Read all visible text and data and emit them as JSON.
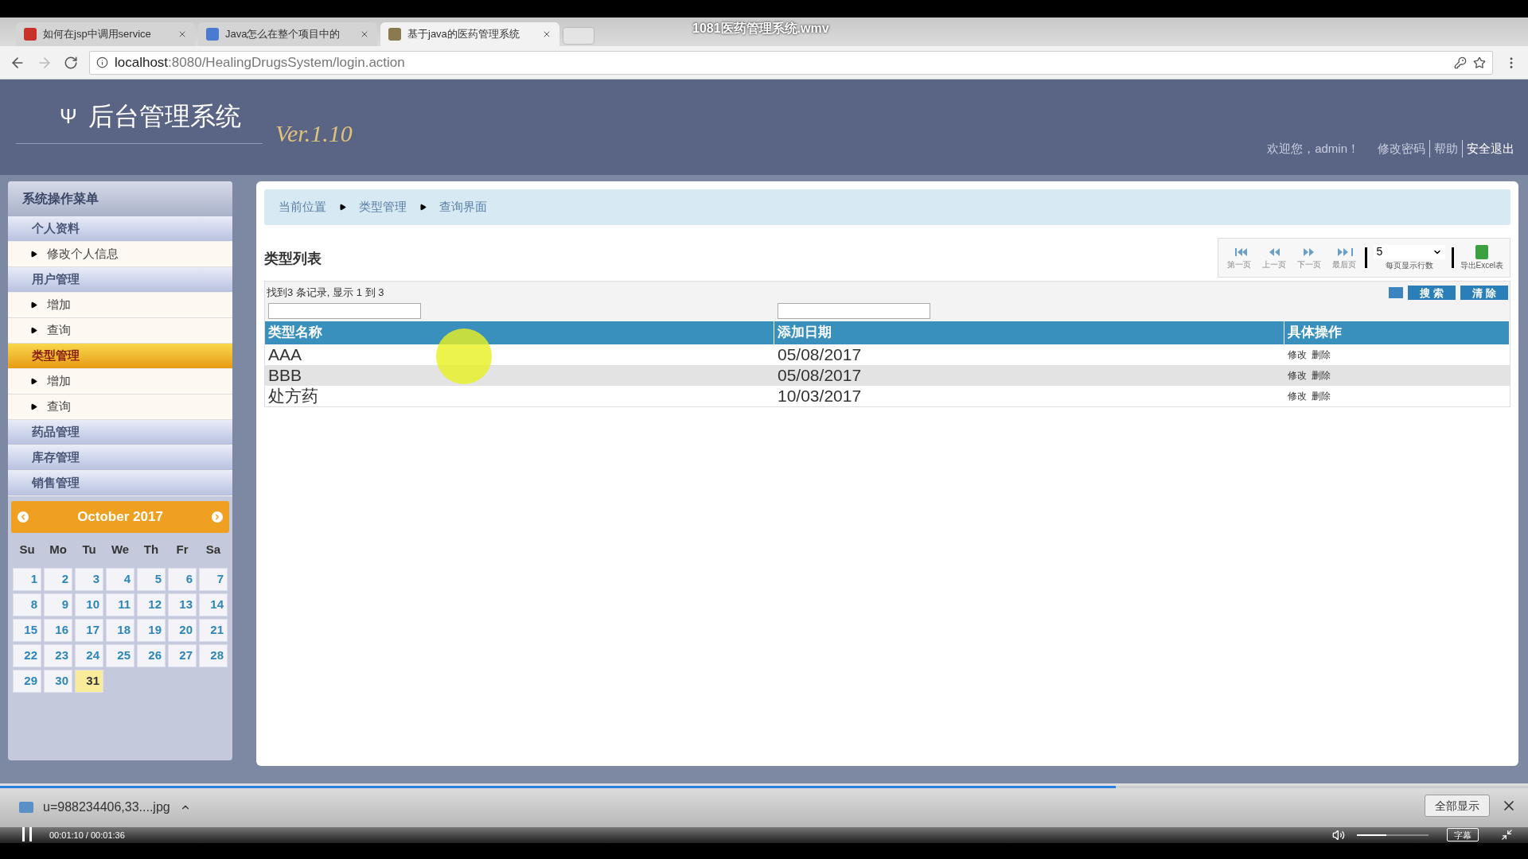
{
  "video": {
    "title": "1081医药管理系统.wmv",
    "time": "00:01:10 / 00:01:36",
    "progress": {
      "level": 0.73
    },
    "volume": {
      "level": 0.41
    },
    "subtitle_button": "字幕"
  },
  "browser": {
    "tabs": [
      {
        "label": "如何在jsp中调用service",
        "selected": false
      },
      {
        "label": "Java怎么在整个项目中的",
        "selected": false
      },
      {
        "label": "基于java的医药管理系统",
        "selected": true
      }
    ],
    "address": {
      "host": "localhost",
      "rest": ":8080/HealingDrugsSystem/login.action"
    }
  },
  "header": {
    "logo": "Ψ",
    "title": "后台管理系统",
    "version": "Ver.1.10",
    "welcome": "欢迎您，admin！",
    "links": [
      "修改密码",
      "帮助",
      "安全退出"
    ]
  },
  "sidebar": {
    "title": "系统操作菜单",
    "items": [
      {
        "kind": "group",
        "label": "个人资料",
        "selected": false
      },
      {
        "kind": "link",
        "label": "修改个人信息",
        "selected": false
      },
      {
        "kind": "group",
        "label": "用户管理",
        "selected": false
      },
      {
        "kind": "link",
        "label": "增加",
        "selected": false
      },
      {
        "kind": "link",
        "label": "查询",
        "selected": false
      },
      {
        "kind": "group",
        "label": "类型管理",
        "selected": true
      },
      {
        "kind": "link",
        "label": "增加",
        "selected": false
      },
      {
        "kind": "link",
        "label": "查询",
        "selected": false
      },
      {
        "kind": "group",
        "label": "药品管理",
        "selected": false
      },
      {
        "kind": "group",
        "label": "库存管理",
        "selected": false
      },
      {
        "kind": "group",
        "label": "销售管理",
        "selected": false
      }
    ]
  },
  "calendar": {
    "title": "October 2017",
    "weekdays": [
      "Su",
      "Mo",
      "Tu",
      "We",
      "Th",
      "Fr",
      "Sa"
    ],
    "days": [
      {
        "label": "1",
        "selected": false
      },
      {
        "label": "2",
        "selected": false
      },
      {
        "label": "3",
        "selected": false
      },
      {
        "label": "4",
        "selected": false
      },
      {
        "label": "5",
        "selected": false
      },
      {
        "label": "6",
        "selected": false
      },
      {
        "label": "7",
        "selected": false
      },
      {
        "label": "8",
        "selected": false
      },
      {
        "label": "9",
        "selected": false
      },
      {
        "label": "10",
        "selected": false
      },
      {
        "label": "11",
        "selected": false
      },
      {
        "label": "12",
        "selected": false
      },
      {
        "label": "13",
        "selected": false
      },
      {
        "label": "14",
        "selected": false
      },
      {
        "label": "15",
        "selected": false
      },
      {
        "label": "16",
        "selected": false
      },
      {
        "label": "17",
        "selected": false
      },
      {
        "label": "18",
        "selected": false
      },
      {
        "label": "19",
        "selected": false
      },
      {
        "label": "20",
        "selected": false
      },
      {
        "label": "21",
        "selected": false
      },
      {
        "label": "22",
        "selected": false
      },
      {
        "label": "23",
        "selected": false
      },
      {
        "label": "24",
        "selected": false
      },
      {
        "label": "25",
        "selected": false
      },
      {
        "label": "26",
        "selected": false
      },
      {
        "label": "27",
        "selected": false
      },
      {
        "label": "28",
        "selected": false
      },
      {
        "label": "29",
        "selected": false
      },
      {
        "label": "30",
        "selected": false
      },
      {
        "label": "31",
        "selected": true
      }
    ]
  },
  "breadcrumb": [
    "当前位置",
    "类型管理",
    "查询界面"
  ],
  "list": {
    "title": "类型列表",
    "pager": [
      "第一页",
      "上一页",
      "下一页",
      "最后页"
    ],
    "page_size": {
      "value": "5",
      "label": "每页显示行数"
    },
    "export": "导出Excel表",
    "summary": "找到3 条记录, 显示 1 到 3",
    "search_button": "搜 索",
    "clear_button": "清 除"
  },
  "table": {
    "columns": [
      "类型名称",
      "添加日期",
      "具体操作"
    ],
    "rows": [
      {
        "name": "AAA",
        "date": "05/08/2017",
        "actions": [
          "修改",
          "删除"
        ]
      },
      {
        "name": "BBB",
        "date": "05/08/2017",
        "actions": [
          "修改",
          "删除"
        ]
      },
      {
        "name": "处方药",
        "date": "10/03/2017",
        "actions": [
          "修改",
          "删除"
        ]
      }
    ]
  },
  "downloads": {
    "file": "u=988234406,33....jpg",
    "show_all": "全部显示"
  }
}
